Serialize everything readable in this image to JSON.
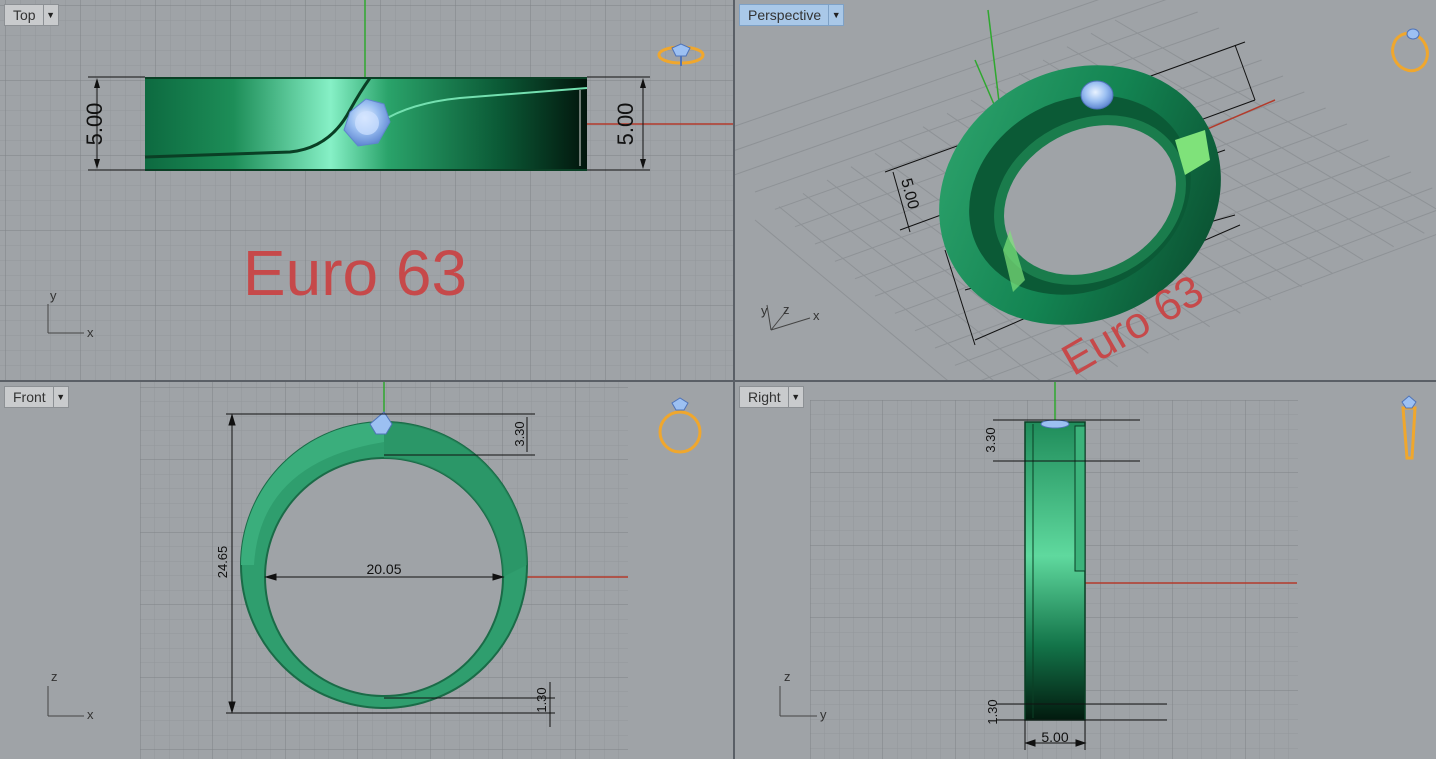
{
  "viewports": {
    "top": {
      "label": "Top",
      "active": false
    },
    "perspective": {
      "label": "Perspective",
      "active": true
    },
    "front": {
      "label": "Front",
      "active": false
    },
    "right": {
      "label": "Right",
      "active": false
    }
  },
  "annotation_text": "Euro 63",
  "dimensions": {
    "width": "5.00",
    "stone_height": "3.30",
    "outer_height": "24.65",
    "inner_diameter": "20.05",
    "bottom_thickness": "1.30"
  },
  "axes": {
    "top": [
      "x",
      "y"
    ],
    "perspective": [
      "x",
      "y",
      "z"
    ],
    "front": [
      "x",
      "z"
    ],
    "right": [
      "y",
      "z"
    ]
  },
  "icons": {
    "top": "ring-top-icon",
    "perspective": "ring-perspective-icon",
    "front": "ring-front-icon",
    "right": "ring-side-icon"
  },
  "colors": {
    "ring_green": "#2f9e6e",
    "ring_dark": "#063c24",
    "gem_blue": "#9cc0f2",
    "dimension_text": "#111111",
    "annotation_red": "#c6494a",
    "viewport_bg": "#9fa3a7",
    "icon_orange": "#f0a72d",
    "axis_green": "#2fa82f",
    "axis_red": "#b33b2b"
  }
}
